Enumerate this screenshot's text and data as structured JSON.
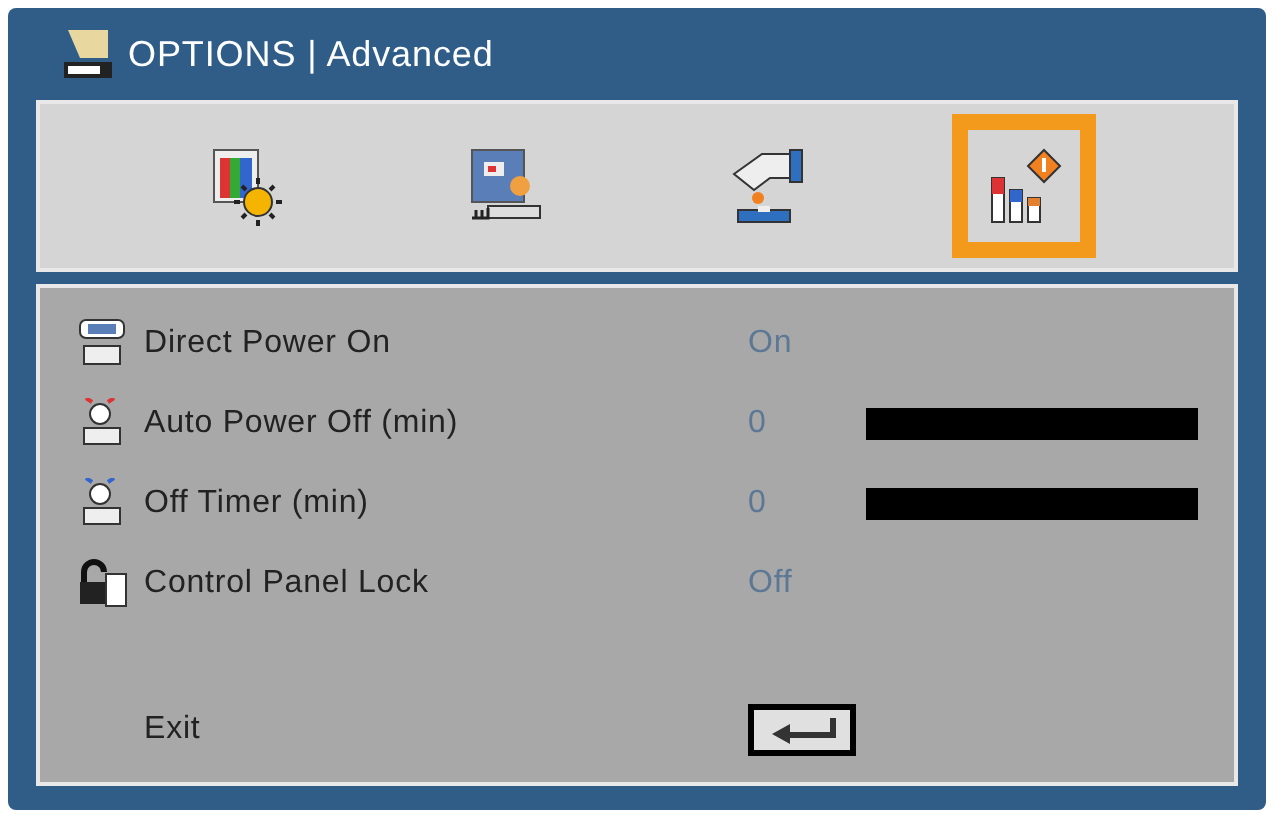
{
  "window": {
    "title": "OPTIONS | Advanced"
  },
  "tabs": [
    {
      "selected": false
    },
    {
      "selected": false
    },
    {
      "selected": false
    },
    {
      "selected": true
    }
  ],
  "items": [
    {
      "kind": "value",
      "label": "Direct Power On",
      "value": "On"
    },
    {
      "kind": "slider",
      "label": "Auto Power Off (min)",
      "value": "0",
      "level": 0
    },
    {
      "kind": "slider",
      "label": "Off Timer (min)",
      "value": "0",
      "level": 0
    },
    {
      "kind": "value",
      "label": "Control Panel Lock",
      "value": "Off"
    }
  ],
  "exit": {
    "label": "Exit"
  }
}
